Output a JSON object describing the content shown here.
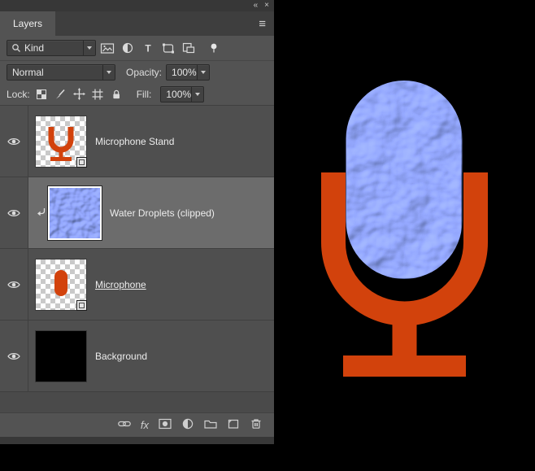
{
  "window": {
    "collapse_icon": "«",
    "close_icon": "×"
  },
  "panel": {
    "tab_label": "Layers",
    "menu_icon": "≡"
  },
  "filter_row": {
    "kind_label": "Kind"
  },
  "blend_row": {
    "mode_value": "Normal",
    "opacity_label": "Opacity:",
    "opacity_value": "100%"
  },
  "lock_row": {
    "lock_label": "Lock:",
    "fill_label": "Fill:",
    "fill_value": "100%"
  },
  "layers": [
    {
      "name": "Microphone Stand",
      "visible": true,
      "type": "smart-object"
    },
    {
      "name": "Water Droplets (clipped)",
      "visible": true,
      "selected": true,
      "clipped": true
    },
    {
      "name": "Microphone",
      "visible": true,
      "type": "smart-object",
      "name_underlined": true
    },
    {
      "name": "Background",
      "visible": true
    }
  ],
  "footer": {
    "fx_label": "fx"
  },
  "icons": {
    "search": "magnifier",
    "chevron_down": "triangle-down",
    "type_glyph": "T",
    "filter_buttons": [
      "pixel-layer-filter",
      "adjustment-layer-filter",
      "type-layer-filter",
      "shape-layer-filter",
      "smart-object-filter",
      "filter-toggle"
    ],
    "lock_buttons": [
      "lock-transparent-pixels",
      "lock-image-pixels",
      "lock-position",
      "lock-artboard",
      "lock-all"
    ],
    "footer_buttons": [
      "link-layers",
      "layer-style-fx",
      "add-layer-mask",
      "new-adjustment-layer",
      "new-group",
      "new-layer",
      "delete-layer"
    ]
  },
  "colors": {
    "stand_orange": "#d2420c",
    "droplet_blue": "#4a5ec9",
    "panel_bg": "#535353",
    "selected_row_bg": "#6c6c6c",
    "canvas_bg": "#000000"
  }
}
